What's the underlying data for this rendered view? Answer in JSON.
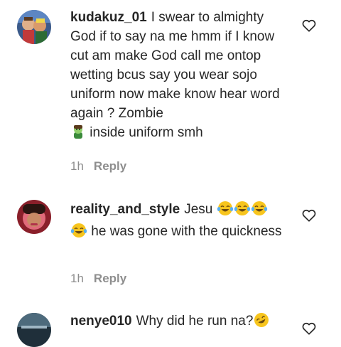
{
  "comments": [
    {
      "username": "kudakuz_01",
      "text": "I swear to almighty God if to say na me hmm if I know cut am make God call me ontop wetting bcus say you wear sojo uniform now make know hear word again ? Zombie",
      "text_tail": " inside uniform smh",
      "time": "1h",
      "reply_label": "Reply",
      "avatar_icon": "avatar-photo",
      "emoji_icon": "zombie-emoji"
    },
    {
      "username": "reality_and_style",
      "text_head": "Jesu ",
      "text": " he was gone with the quickness",
      "time": "1h",
      "reply_label": "Reply",
      "avatar_icon": "avatar-photo",
      "emoji_icon": "tears-of-joy-emoji"
    },
    {
      "username": "nenye010",
      "text": "Why did he run na?",
      "time": "",
      "reply_label": "",
      "avatar_icon": "avatar-photo",
      "emoji_icon": "rolling-laughing-emoji"
    }
  ],
  "colors": {
    "text": "#262626",
    "muted": "#8e8e8e",
    "emoji_yellow": "#f7c51e"
  }
}
